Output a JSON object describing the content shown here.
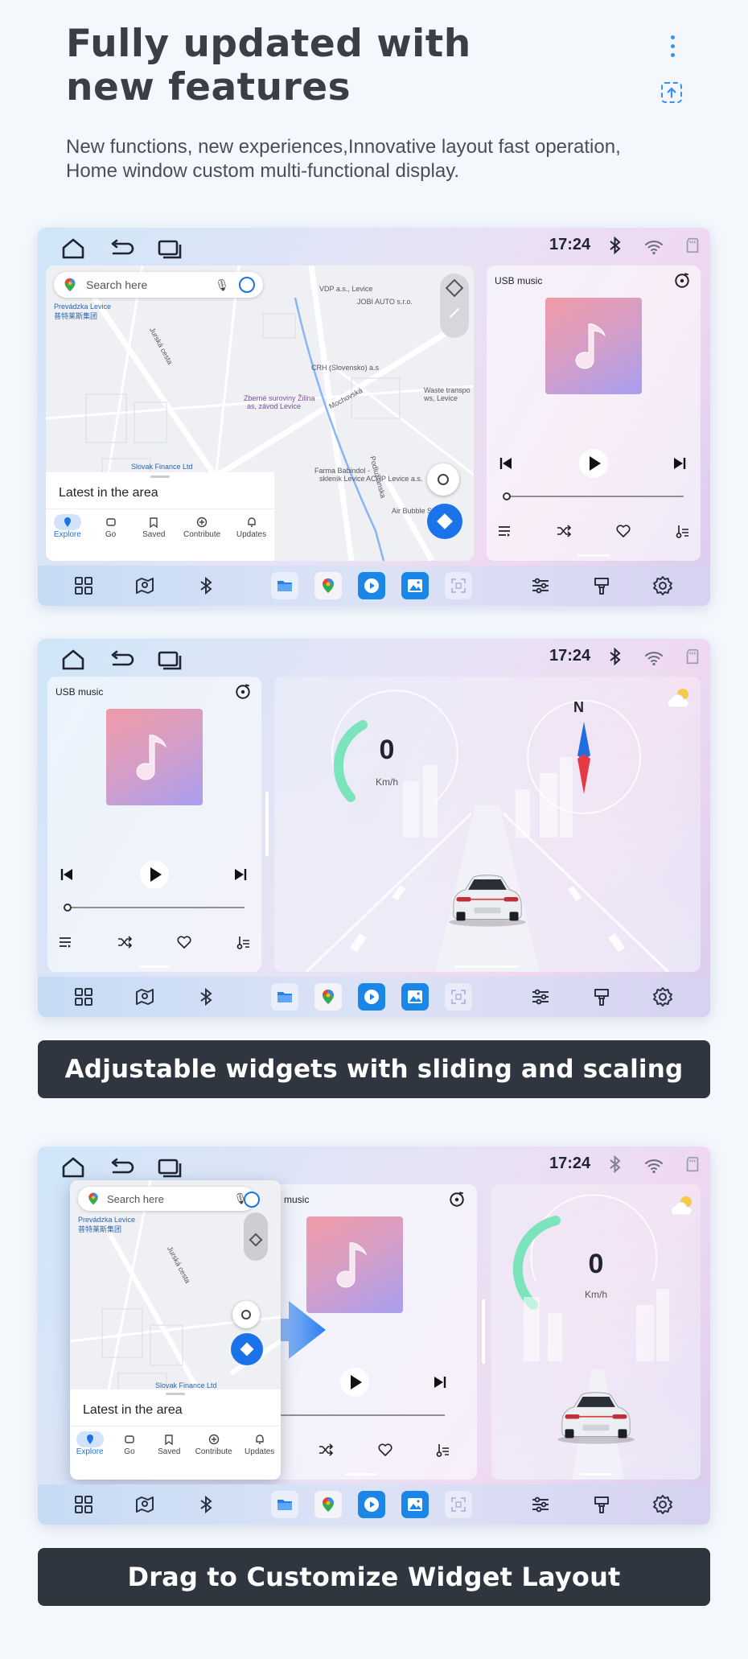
{
  "header": {
    "title": "Fully updated with new features",
    "title_line1": "Fully updated with",
    "title_line2": "new features",
    "subtitle_line1": "New functions, new experiences,Innovative layout fast operation,",
    "subtitle_line2": "Home window custom multi-functional display."
  },
  "status": {
    "time": "17:24"
  },
  "map": {
    "search_placeholder": "Search here",
    "latest": "Latest in the area",
    "tabs": [
      "Explore",
      "Go",
      "Saved",
      "Contribute",
      "Updates"
    ],
    "labels": {
      "prevadzka": "Prevádzka Levice",
      "chinese": "普特莱斯集团",
      "vdp": "VDP a.s., Levice",
      "jobi": "JOBI AUTO s.r.o.",
      "crh": "CRH (Slovensko) a.s",
      "zberne": "Zberné suroviny Žilina",
      "zberne2": "as, závod Levice",
      "waste": "Waste transpo",
      "waste2": "ws, Levice",
      "slovak": "Slovak Finance Ltd",
      "farma": "Farma Babindol -",
      "farma2": "skleník Levice",
      "achp": "ACHP Levice a.s.",
      "airbubble": "Air Bubble S",
      "jurska": "Jurská cesta",
      "mochovska": "Mochovská",
      "podlu": "Podlužianska"
    }
  },
  "music": {
    "title": "USB music"
  },
  "speed": {
    "value": "0",
    "unit": "Km/h"
  },
  "compass": {
    "north": "N"
  },
  "banners": {
    "first": "Adjustable widgets with sliding and scaling",
    "second": "Drag to Customize Widget Layout"
  },
  "colors": {
    "accent_blue": "#1a73e8",
    "banner_bg": "#2f363f",
    "title_color": "#3b3f45"
  }
}
